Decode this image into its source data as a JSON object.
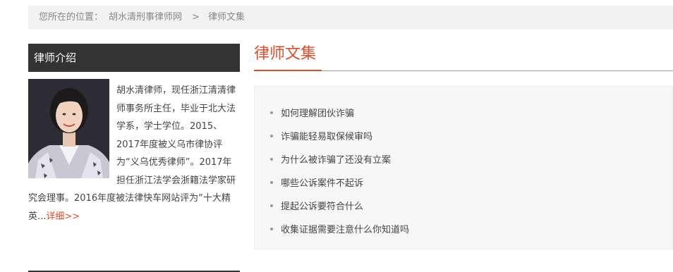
{
  "breadcrumb": {
    "lead": "您所在的位置：",
    "site": "胡水清刑事律师网",
    "sep": ">",
    "current": "律师文集"
  },
  "sidebar": {
    "title": "律师介绍",
    "intro": "胡水清律师，现任浙江清清律师事务所主任，毕业于北大法学系，学士学位。2015、2017年度被义乌市律协评为“义乌优秀律师”。2017年担任浙江法学会浙籍法学家研究会理事。2016年度被法律快车网站评为“十大精英...",
    "more": "详细>>"
  },
  "main": {
    "title": "律师文集",
    "articles": [
      "如何理解团伙诈骗",
      "诈骗能轻易取保候审吗",
      "为什么被诈骗了还没有立案",
      "哪些公诉案件不起诉",
      "提起公诉要符合什么",
      "收集证据需要注意什么你知道吗"
    ]
  },
  "colors": {
    "accent": "#d9502e",
    "side_header_bg": "#333333",
    "breadcrumb_bg": "#f2f2f2",
    "list_bg": "#f7f7f7"
  }
}
